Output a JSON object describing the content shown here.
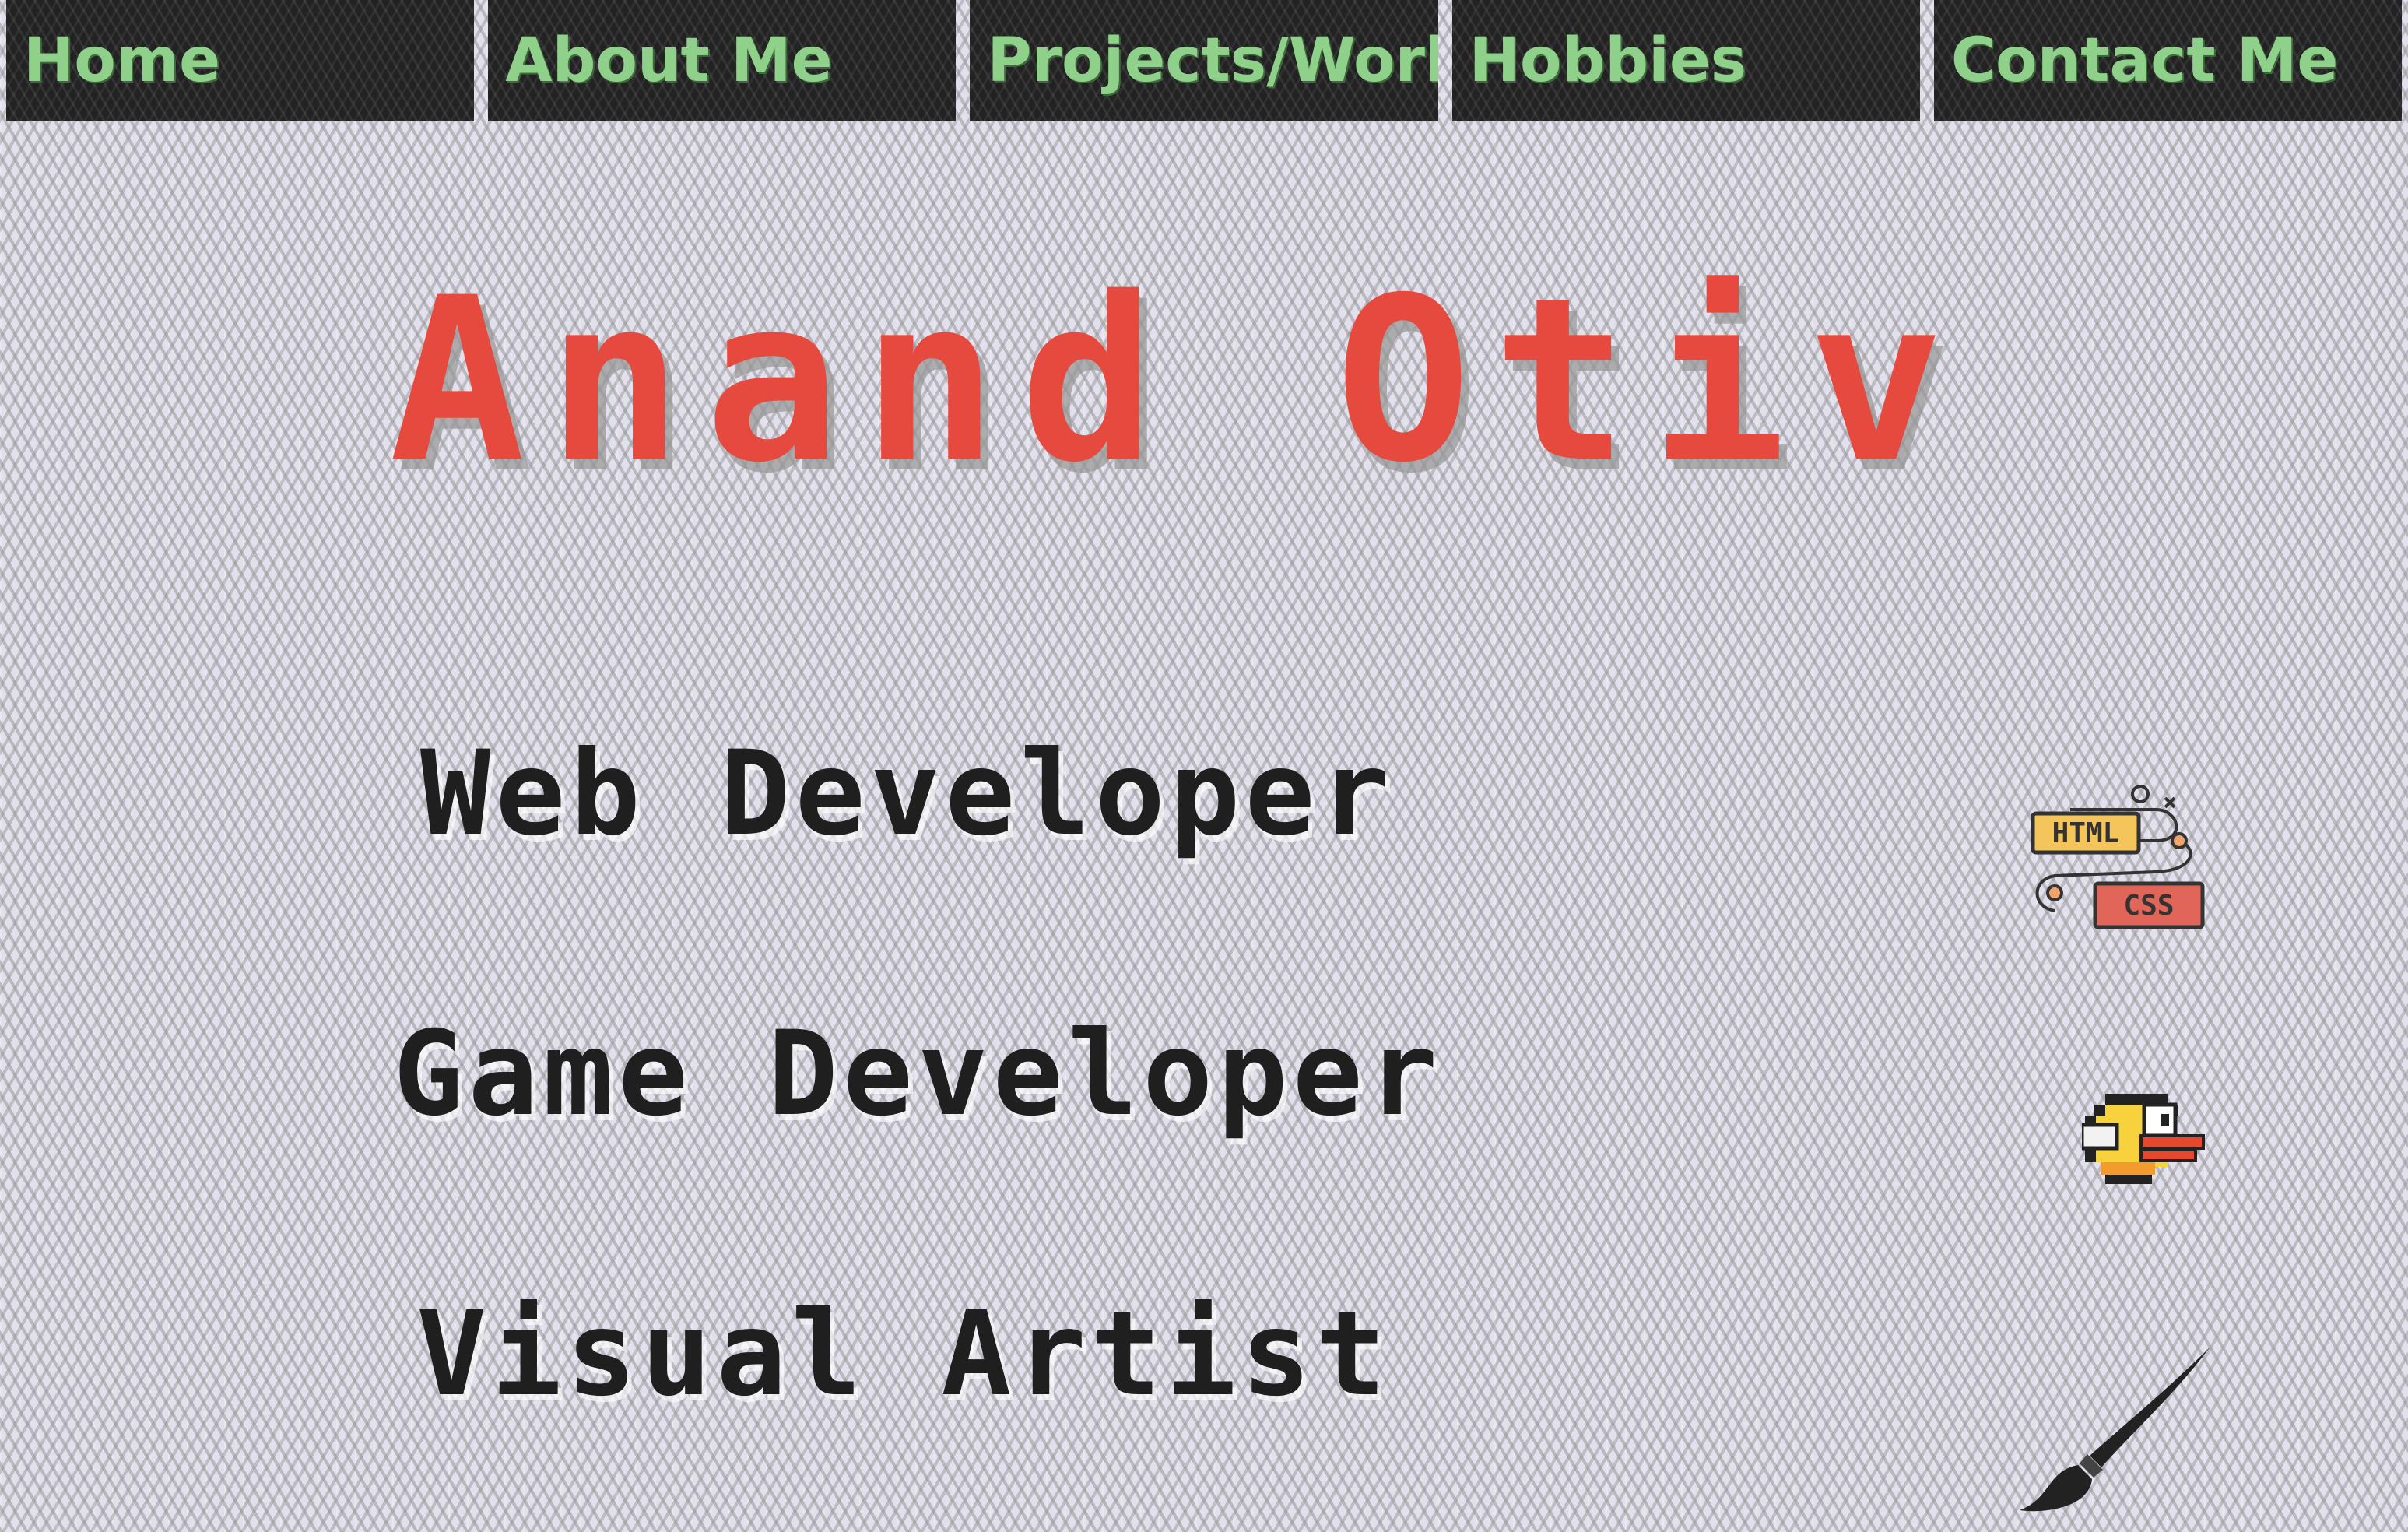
{
  "nav": {
    "items": [
      {
        "label": "Home"
      },
      {
        "label": "About Me"
      },
      {
        "label": "Projects/Work"
      },
      {
        "label": "Hobbies"
      },
      {
        "label": "Contact Me"
      }
    ]
  },
  "hero": {
    "name": "Anand Otiv"
  },
  "roles": [
    {
      "label": "Web Developer",
      "icon": "html-css-icon",
      "icon_text_1": "HTML",
      "icon_text_2": "CSS"
    },
    {
      "label": "Game Developer",
      "icon": "flappy-bird-icon"
    },
    {
      "label": "Visual Artist",
      "icon": "paintbrush-icon"
    }
  ],
  "colors": {
    "nav_bg": "#222222",
    "nav_text": "#8fd18a",
    "title": "#e64a3e",
    "role_text": "#1f1f1f"
  }
}
